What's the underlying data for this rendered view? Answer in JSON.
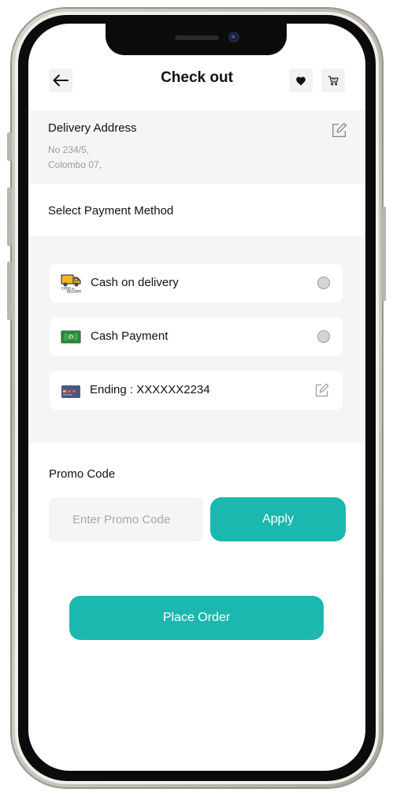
{
  "header": {
    "title": "Check out",
    "back_icon": "arrow-left-icon",
    "favorite_icon": "heart-icon",
    "cart_icon": "cart-icon"
  },
  "delivery_address": {
    "title": "Delivery Address",
    "line1": "No 234/5,",
    "line2": "Colombo 07,",
    "edit_icon": "edit-icon"
  },
  "payment": {
    "title": "Select Payment Method",
    "methods": [
      {
        "label": "Cash on delivery",
        "icon": "delivery-truck-icon",
        "control": "radio",
        "selected": false
      },
      {
        "label": "Cash Payment",
        "icon": "cash-icon",
        "control": "radio",
        "selected": false
      },
      {
        "label": "Ending : XXXXXX2234",
        "icon": "credit-card-icon",
        "control": "edit",
        "selected": false
      }
    ]
  },
  "promo": {
    "title": "Promo Code",
    "placeholder": "Enter Promo Code",
    "value": "",
    "apply_label": "Apply"
  },
  "place_order_label": "Place Order",
  "colors": {
    "accent": "#1ab8ae",
    "section_bg": "#f5f5f5",
    "text": "#111111",
    "muted": "#9a9a9a"
  }
}
